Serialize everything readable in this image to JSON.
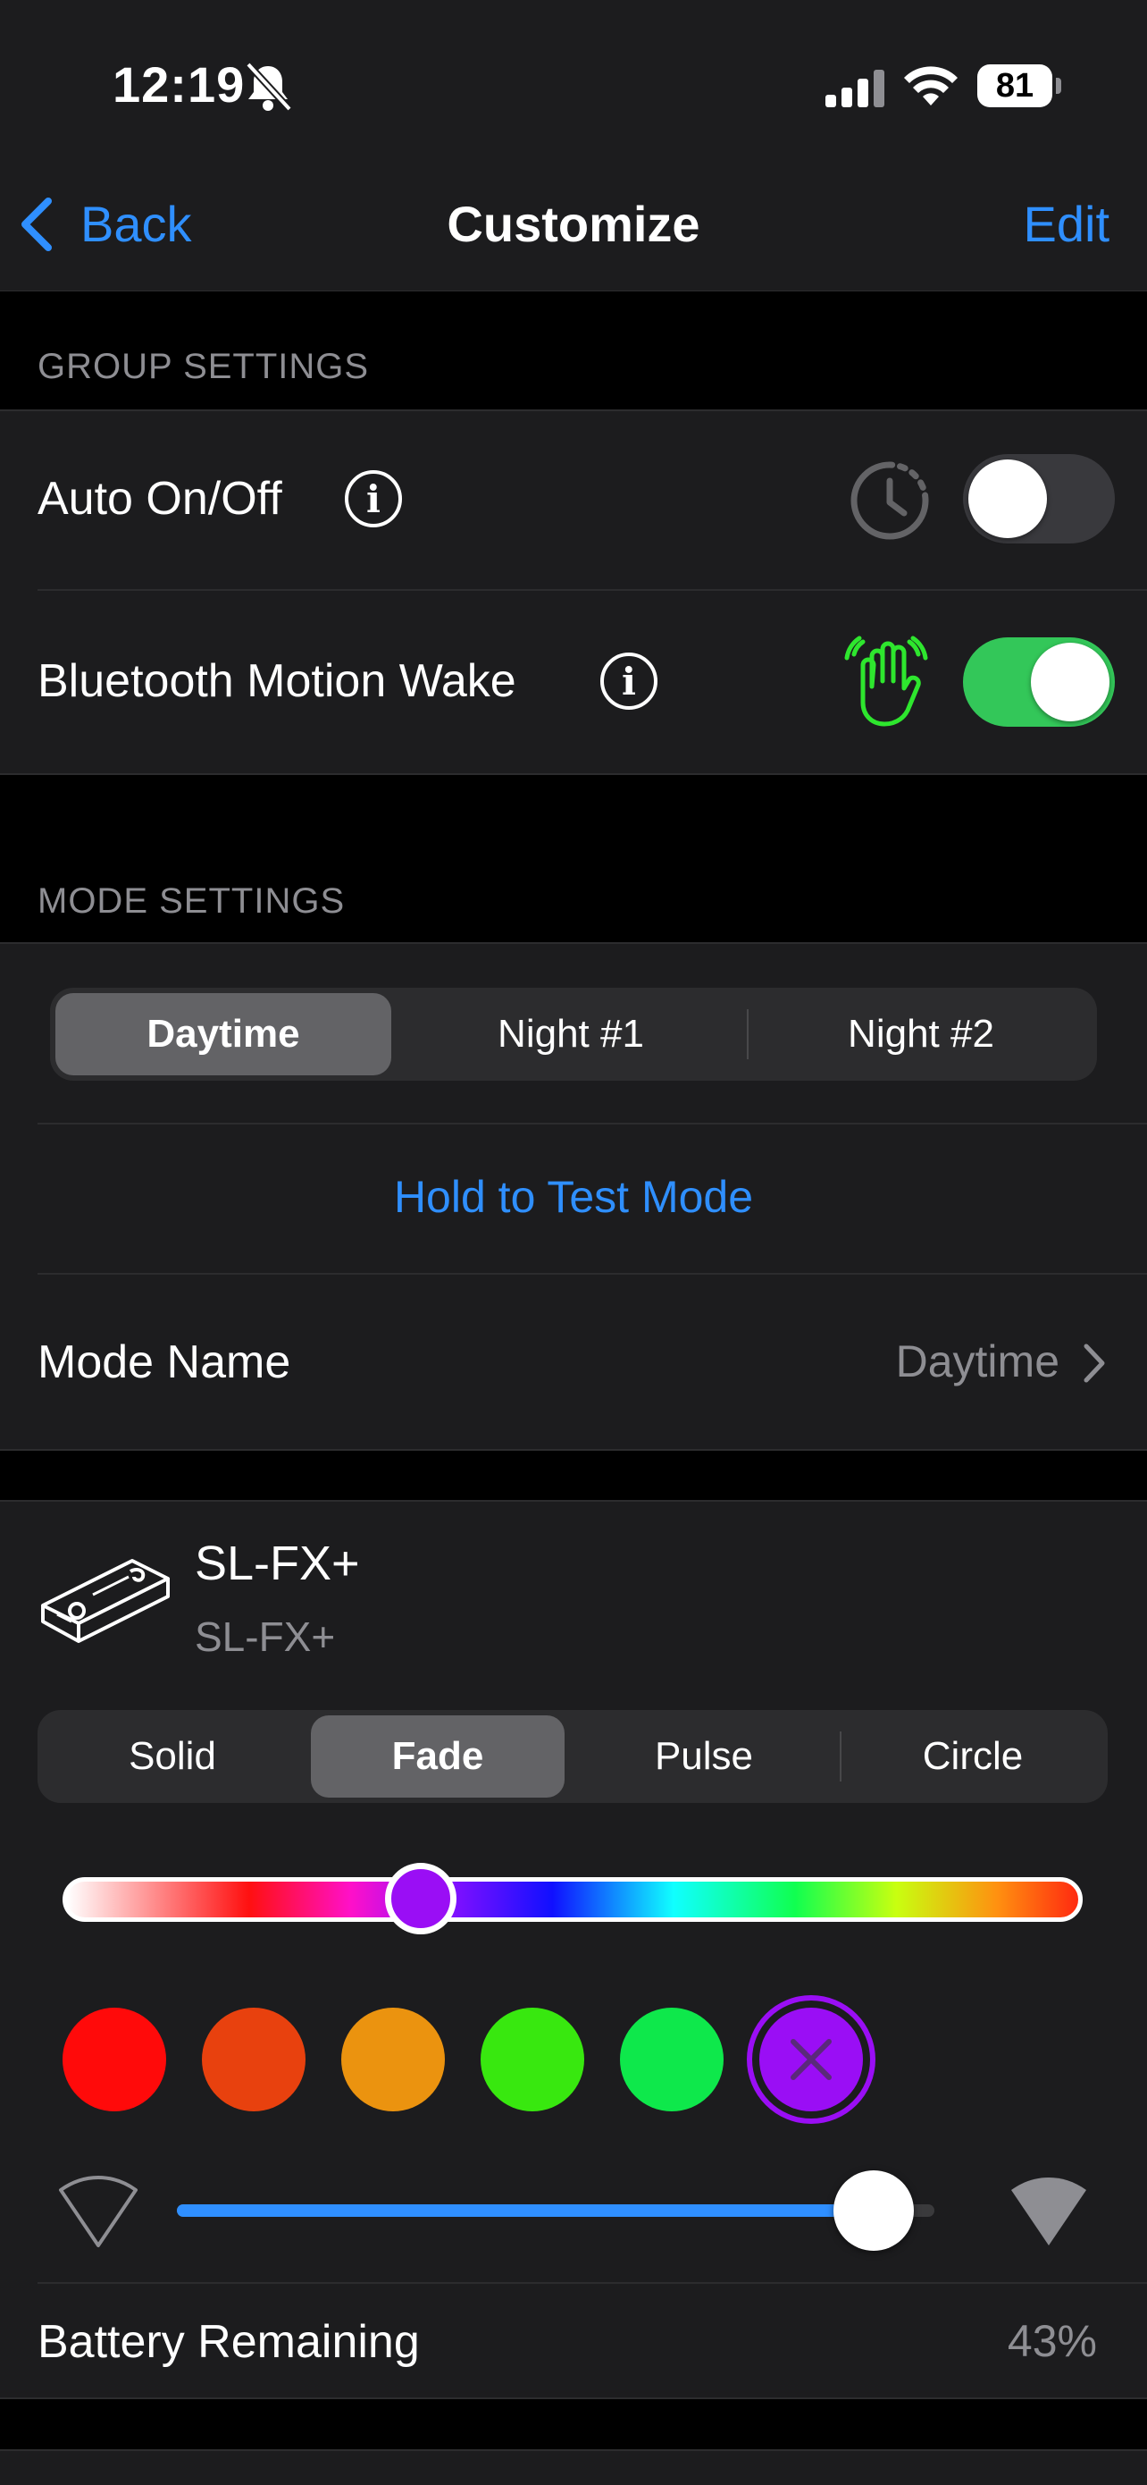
{
  "status_bar": {
    "time": "12:19",
    "battery": "81"
  },
  "nav": {
    "back_label": "Back",
    "title": "Customize",
    "edit_label": "Edit"
  },
  "group_settings": {
    "header": "GROUP SETTINGS",
    "auto_on_off": {
      "label": "Auto On/Off",
      "enabled": false
    },
    "motion_wake": {
      "label": "Bluetooth Motion Wake",
      "enabled": true
    }
  },
  "mode_settings": {
    "header": "MODE SETTINGS",
    "tabs": [
      "Daytime",
      "Night #1",
      "Night #2"
    ],
    "selected_tab": "Daytime",
    "test_button": "Hold to Test Mode",
    "mode_name_label": "Mode Name",
    "mode_name_value": "Daytime"
  },
  "device": {
    "name": "SL-FX+",
    "model": "SL-FX+",
    "effects": [
      "Solid",
      "Fade",
      "Pulse",
      "Circle"
    ],
    "selected_effect": "Fade",
    "hue_position": 0.35,
    "swatches": [
      "#ff0a0a",
      "#e8410e",
      "#eb930f",
      "#38e80f",
      "#0ee84b",
      "#9a0ef5"
    ],
    "selected_swatch": "#9a0ef5",
    "brightness": 0.92,
    "battery_label": "Battery Remaining",
    "battery_value": "43%"
  },
  "colors": {
    "accent": "#2f8fff",
    "toggle_on": "#33c759",
    "motion_icon": "#2ee62e"
  }
}
